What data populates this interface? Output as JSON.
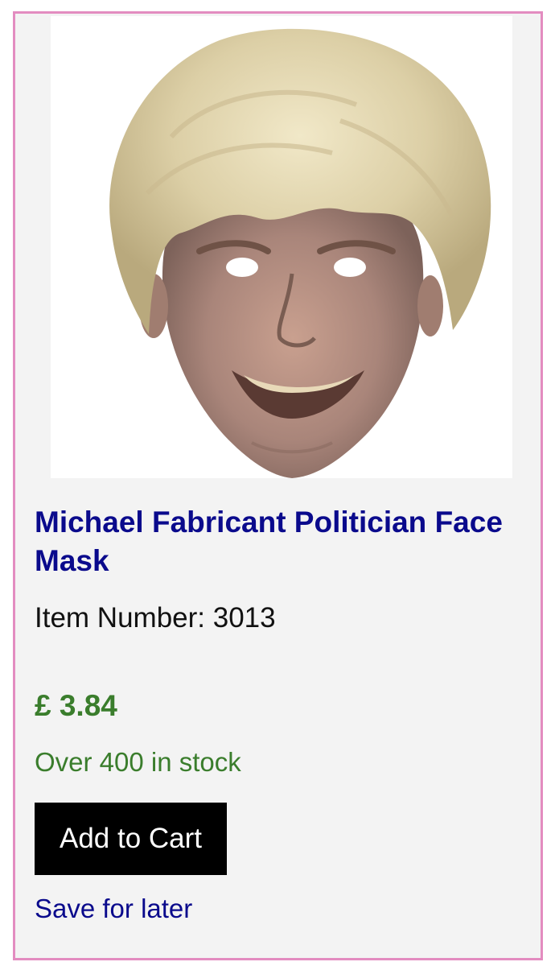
{
  "product": {
    "image": {
      "alt": "Michael Fabricant Politician Face Mask"
    },
    "title": "Michael Fabricant Politician Face Mask",
    "item_number": "Item Number: 3013",
    "price": "£ 3.84",
    "stock": "Over 400 in stock"
  },
  "actions": {
    "add_to_cart": "Add to Cart",
    "save_for_later": "Save for later"
  },
  "colors": {
    "card_border": "#e38cc0",
    "card_background": "#f3f3f3",
    "title": "#0a0a8c",
    "price": "#3a7d2c",
    "stock": "#3a7d2c",
    "button_background": "#000000",
    "button_text": "#ffffff",
    "link": "#0a0a8c"
  }
}
